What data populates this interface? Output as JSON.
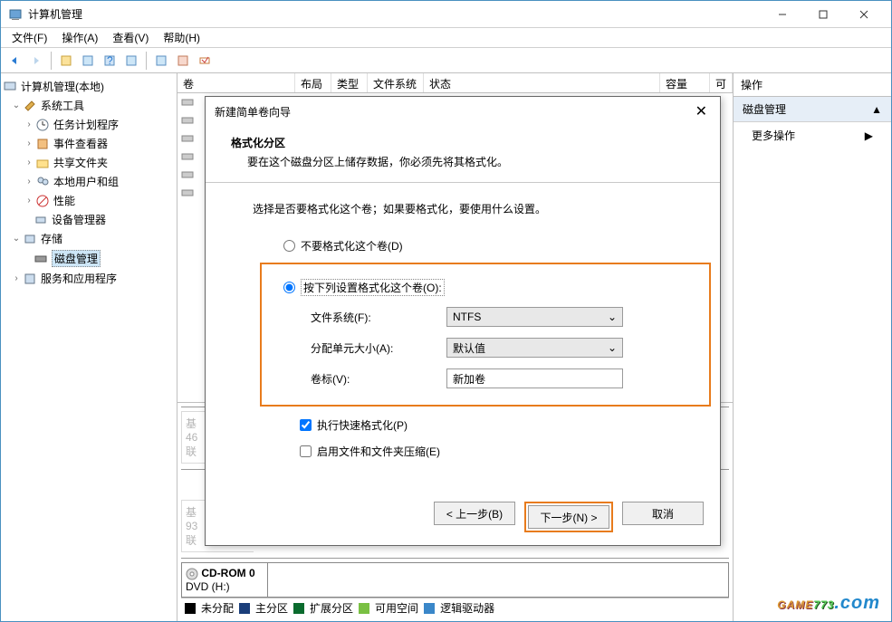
{
  "window": {
    "title": "计算机管理"
  },
  "menu": {
    "file": "文件(F)",
    "action": "操作(A)",
    "view": "查看(V)",
    "help": "帮助(H)"
  },
  "tree": {
    "root": "计算机管理(本地)",
    "system_tools": "系统工具",
    "task_scheduler": "任务计划程序",
    "event_viewer": "事件查看器",
    "shared_folders": "共享文件夹",
    "local_users": "本地用户和组",
    "performance": "性能",
    "device_manager": "设备管理器",
    "storage": "存储",
    "disk_management": "磁盘管理",
    "services_apps": "服务和应用程序"
  },
  "columns": {
    "volume": "卷",
    "layout": "布局",
    "type": "类型",
    "filesystem": "文件系统",
    "status": "状态",
    "capacity": "容量",
    "free": "可"
  },
  "bottom": {
    "basic": "基",
    "num46": "46",
    "online": "联",
    "num93": "93",
    "cdrom": "CD-ROM 0",
    "dvd": "DVD (H:)"
  },
  "legend": {
    "unalloc": "未分配",
    "primary": "主分区",
    "extended": "扩展分区",
    "free": "可用空间",
    "logical": "逻辑驱动器"
  },
  "actions": {
    "header": "操作",
    "disk_management": "磁盘管理",
    "more": "更多操作"
  },
  "wizard": {
    "title": "新建简单卷向导",
    "heading": "格式化分区",
    "subheading": "要在这个磁盘分区上储存数据，你必须先将其格式化。",
    "intro": "选择是否要格式化这个卷；如果要格式化，要使用什么设置。",
    "radio_no_format": "不要格式化这个卷(D)",
    "radio_format": "按下列设置格式化这个卷(O):",
    "fs_label": "文件系统(F):",
    "fs_value": "NTFS",
    "alloc_label": "分配单元大小(A):",
    "alloc_value": "默认值",
    "vol_label": "卷标(V):",
    "vol_value": "新加卷",
    "quick_format": "执行快速格式化(P)",
    "compression": "启用文件和文件夹压缩(E)",
    "back": "< 上一步(B)",
    "next": "下一步(N) >",
    "cancel": "取消"
  },
  "watermark": {
    "p1": "GAME",
    "p2": "773",
    "p3": ".com"
  }
}
